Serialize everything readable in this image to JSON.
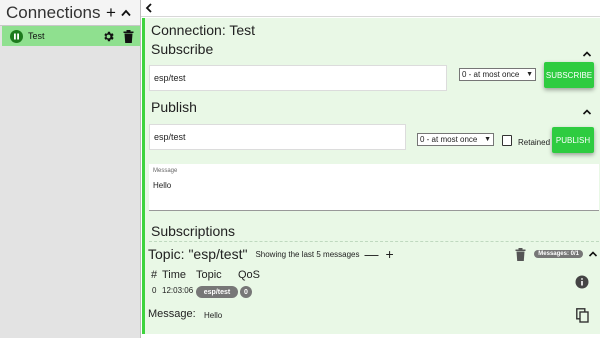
{
  "sidebar": {
    "title": "Connections",
    "add_label": "+",
    "connections": [
      {
        "name": "Test",
        "status": "connected"
      }
    ]
  },
  "main": {
    "connection_title": "Connection: Test",
    "subscribe": {
      "title": "Subscribe",
      "topic": "esp/test",
      "qos": "0 - at most once",
      "button": "SUBSCRIBE"
    },
    "publish": {
      "title": "Publish",
      "topic": "esp/test",
      "qos": "0 - at most once",
      "retained_label": "Retained",
      "retained_checked": false,
      "button": "PUBLISH",
      "message_label": "Message",
      "message_value": "Hello"
    },
    "subscriptions": {
      "title": "Subscriptions",
      "topic_title": "Topic: \"esp/test\"",
      "showing_text": "Showing the last 5 messages",
      "minus": "—",
      "plus": "+",
      "messages_badge": "Messages: 0/1",
      "columns": [
        "#",
        "Time",
        "Topic",
        "QoS"
      ],
      "rows": [
        {
          "index": "0",
          "time": "12:03:06",
          "topic": "esp/test",
          "qos": "0"
        }
      ],
      "message_label": "Message:",
      "message_value": "Hello"
    }
  },
  "colors": {
    "accent_green": "#2ecc40",
    "active_connection": "#8fe08f",
    "panel_bg": "#e9f8e6",
    "panel_border": "#3ed43e",
    "badge_gray": "#777777"
  },
  "icons": {
    "sidebar_add": "plus-icon",
    "sidebar_collapse": "chevron-up-icon",
    "connection_status": "pause-icon",
    "connection_settings": "gear-icon",
    "connection_delete": "trash-icon",
    "back": "chevron-left-icon",
    "info": "info-icon",
    "copy": "copy-icon"
  }
}
